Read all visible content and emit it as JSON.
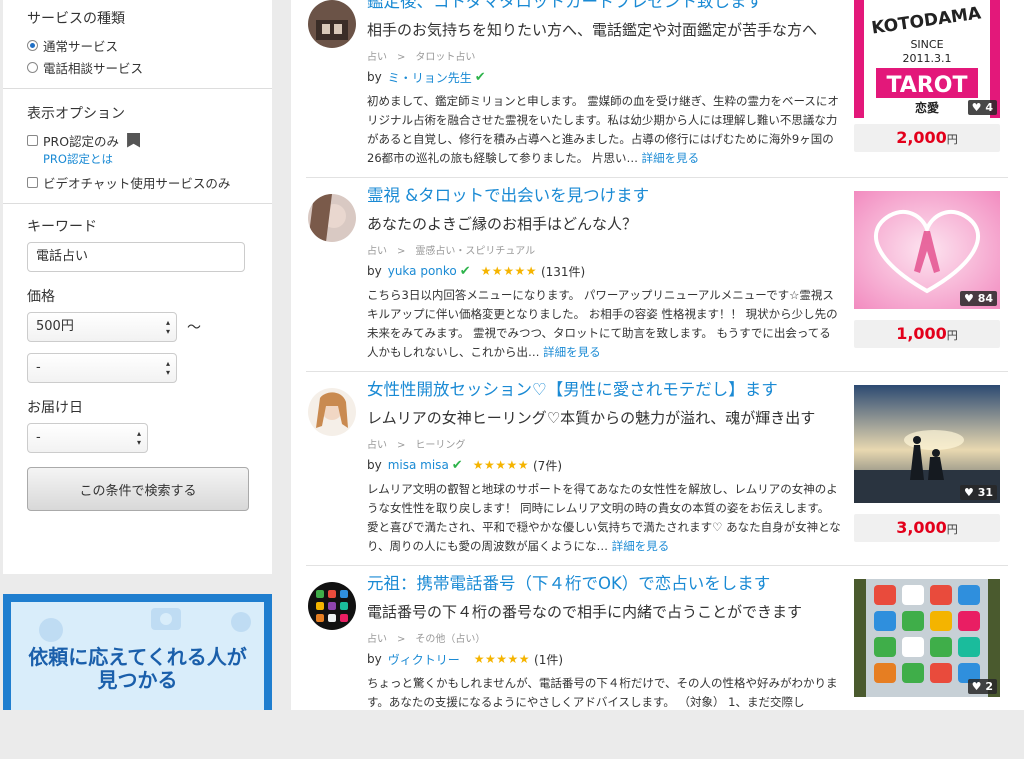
{
  "sidebar": {
    "service_type_title": "サービスの種類",
    "service_types": [
      {
        "label": "通常サービス",
        "selected": true
      },
      {
        "label": "電話相談サービス",
        "selected": false
      }
    ],
    "display_title": "表示オプション",
    "pro_only": "PRO認定のみ",
    "pro_link": "PRO認定とは",
    "video_chat": "ビデオチャット使用サービスのみ",
    "keyword_label": "キーワード",
    "keyword_value": "電話占い",
    "price_label": "価格",
    "price_min": "500円",
    "price_tilde": "〜",
    "price_max": "-",
    "delivery_label": "お届け日",
    "delivery_value": "-",
    "search_button": "この条件で検索する"
  },
  "banner": {
    "line1": "依頼に応えてくれる人が",
    "line2": "見つかる"
  },
  "listings": [
    {
      "title": "鑑定後、コトダマタロットカードプレゼント致します",
      "subtitle": "相手のお気持ちを知りたい方へ、電話鑑定や対面鑑定が苦手な方へ",
      "cat1": "占い",
      "cat2": "タロット占い",
      "by": "by",
      "seller": "ミ・リョン先生",
      "rating": null,
      "reviews": "",
      "desc": "初めまして、鑑定師ミリョンと申します。 霊媒師の血を受け継ぎ、生粋の霊力をベースにオリジナル占術を融合させた霊視をいたします。私は幼少期から人には理解し難い不思議な力があると自覚し、修行を積み占導へと進みました。占導の修行にはげむために海外9ヶ国の26都市の巡礼の旅も経験して参りました。 片思い…",
      "more": "詳細を見る",
      "favorites": "4",
      "price": "2,000",
      "yen": "円",
      "thumb": {
        "brand": "KOTODAMA",
        "since": "SINCE",
        "date": "2011.3.1",
        "word": "TAROT",
        "sub": "恋愛"
      }
    },
    {
      "title": "霊視 &タロットで出会いを見つけます",
      "subtitle": "あなたのよきご縁のお相手はどんな人？",
      "cat1": "占い",
      "cat2": "霊感占い・スピリチュアル",
      "by": "by",
      "seller": "yuka ponko",
      "rating": 5,
      "reviews": "(131件)",
      "desc": "こちら3日以内回答メニューになります。 パワーアップリニューアルメニューです☆霊視スキルアップに伴い価格変更となりました。 お相手の容姿 性格視ます！！ 現状から少し先の未来をみてみます。 霊視でみつつ、タロットにて助言を致します。 もうすでに出会ってる人かもしれないし、これから出…",
      "more": "詳細を見る",
      "favorites": "84",
      "price": "1,000",
      "yen": "円"
    },
    {
      "title": "女性性開放セッション♡【男性に愛されモテだし】ます",
      "subtitle": "レムリアの女神ヒーリング♡本質からの魅力が溢れ、魂が輝き出す",
      "cat1": "占い",
      "cat2": "ヒーリング",
      "by": "by",
      "seller": "misa misa",
      "rating": 5,
      "reviews": "(7件)",
      "desc": "レムリア文明の叡智と地球のサポートを得てあなたの女性性を解放し、レムリアの女神のような女性性を取り戻します！ 同時にレムリア文明の時の貴女の本質の姿をお伝えします。 愛と喜びで満たされ、平和で穏やかな優しい気持ちで満たされます♡ あなた自身が女神となり、周りの人にも愛の周波数が届くようにな…",
      "more": "詳細を見る",
      "favorites": "31",
      "price": "3,000",
      "yen": "円"
    },
    {
      "title": "元祖：携帯電話番号（下４桁でOK）で恋占いをします",
      "subtitle": "電話番号の下４桁の番号なので相手に内緒で占うことができます",
      "cat1": "占い",
      "cat2": "その他（占い）",
      "by": "by",
      "seller": "ヴィクトリー",
      "rating": 5,
      "reviews": "(1件)",
      "desc": "ちょっと驚くかもしれませんが、電話番号の下４桁だけで、その人の性格や好みがわかります。あなたの支援になるようにやさしくアドバイスします。 （対象） 1、まだ交際し",
      "more": "",
      "favorites": "2",
      "price": "",
      "yen": ""
    }
  ],
  "stars_glyph": "★★★★★",
  "category_separator": ">",
  "colors": {
    "link": "#1a8ad4",
    "price": "#e3001b",
    "verified": "#2db34a",
    "star": "#f5b400"
  }
}
